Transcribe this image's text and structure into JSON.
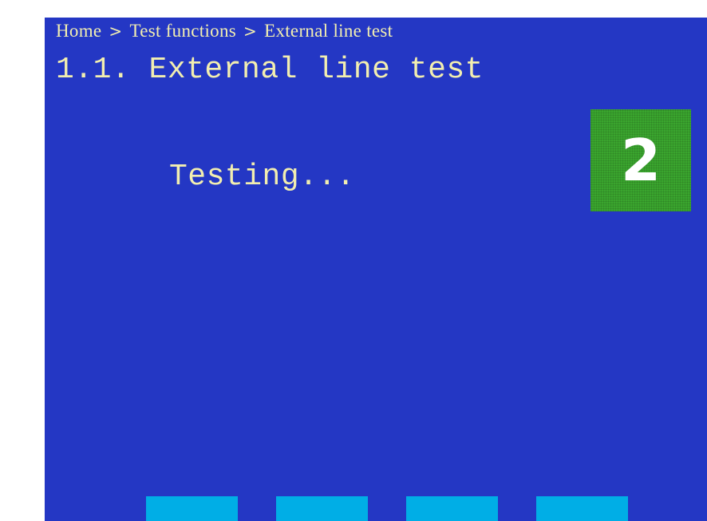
{
  "breadcrumb": {
    "items": [
      "Home",
      "Test functions",
      "External line test"
    ],
    "separator": ">"
  },
  "page_title": "1.1. External line test",
  "status_text": "Testing...",
  "badge": {
    "value": "2"
  },
  "softkeys": [
    {
      "label": ""
    },
    {
      "label": ""
    },
    {
      "label": ""
    },
    {
      "label": ""
    }
  ],
  "colors": {
    "background": "#2437c4",
    "text": "#f2eeb0",
    "badge": "#3aa52e",
    "softkey": "#00aee6"
  }
}
